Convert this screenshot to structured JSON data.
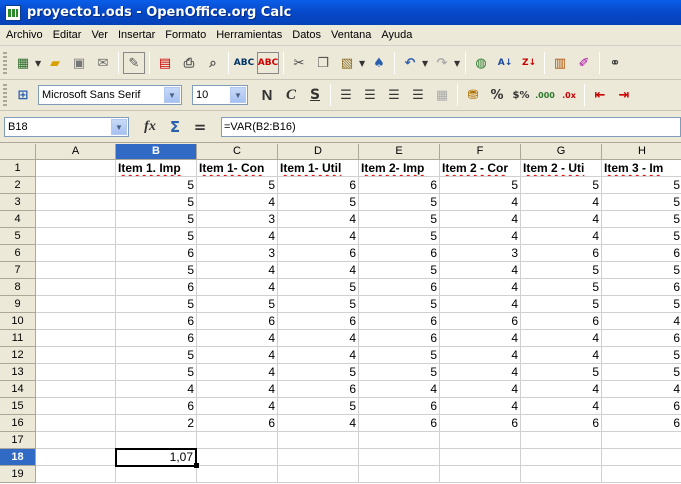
{
  "window": {
    "title": "proyecto1.ods - OpenOffice.org Calc"
  },
  "menu": [
    "Archivo",
    "Editar",
    "Ver",
    "Insertar",
    "Formato",
    "Herramientas",
    "Datos",
    "Ventana",
    "Ayuda"
  ],
  "format_toolbar": {
    "font_name": "Microsoft Sans Serif",
    "font_size": "10"
  },
  "formula_bar": {
    "name_box": "B18",
    "formula": "=VAR(B2:B16)"
  },
  "columns": [
    "A",
    "B",
    "C",
    "D",
    "E",
    "F",
    "G",
    "H"
  ],
  "rows": [
    "1",
    "2",
    "3",
    "4",
    "5",
    "6",
    "7",
    "8",
    "9",
    "10",
    "11",
    "12",
    "13",
    "14",
    "15",
    "16",
    "17",
    "18",
    "19"
  ],
  "header_row": [
    "",
    "Item 1. Imp",
    "Item 1- Con",
    "Item 1- Util",
    "Item 2- Imp",
    "Item 2 - Cor",
    "Item 2 - Uti",
    "Item 3 - Im"
  ],
  "data": [
    [
      5,
      5,
      6,
      6,
      5,
      5,
      5
    ],
    [
      5,
      4,
      5,
      5,
      4,
      4,
      5
    ],
    [
      5,
      3,
      4,
      5,
      4,
      4,
      5
    ],
    [
      5,
      4,
      4,
      5,
      4,
      4,
      5
    ],
    [
      6,
      3,
      6,
      6,
      3,
      6,
      6
    ],
    [
      5,
      4,
      4,
      5,
      4,
      5,
      5
    ],
    [
      6,
      4,
      5,
      6,
      4,
      5,
      6
    ],
    [
      5,
      5,
      5,
      5,
      4,
      5,
      5
    ],
    [
      6,
      6,
      6,
      6,
      6,
      6,
      4
    ],
    [
      6,
      4,
      4,
      6,
      4,
      4,
      6
    ],
    [
      5,
      4,
      4,
      5,
      4,
      4,
      5
    ],
    [
      5,
      4,
      5,
      5,
      4,
      5,
      5
    ],
    [
      4,
      4,
      6,
      4,
      4,
      4,
      4
    ],
    [
      6,
      4,
      5,
      6,
      4,
      4,
      6
    ],
    [
      2,
      6,
      4,
      6,
      6,
      6,
      6
    ]
  ],
  "result_cell": {
    "ref": "B18",
    "value": "1,07"
  }
}
